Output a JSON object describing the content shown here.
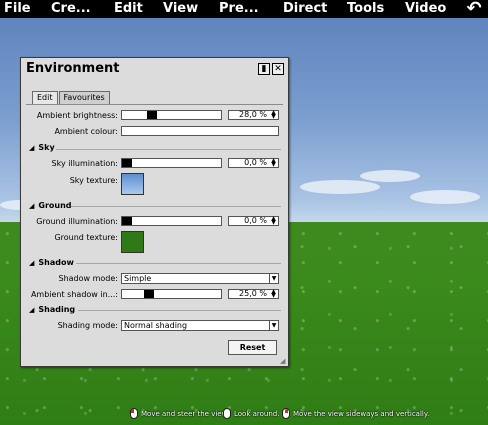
{
  "menu": [
    "File",
    "Cre...",
    "Edit",
    "View",
    "Pre...",
    "Direct",
    "Tools",
    "Video"
  ],
  "undo_symbol": "↶",
  "panel": {
    "title": "Environment",
    "pin_symbol": "▮",
    "close_symbol": "✕",
    "tabs": [
      "Edit",
      "Favourites"
    ],
    "ambient_brightness": {
      "label": "Ambient brightness:",
      "value": "28,0 %",
      "level": 0.28
    },
    "ambient_colour": {
      "label": "Ambient colour:"
    },
    "sky": {
      "title": "Sky",
      "illumination": {
        "label": "Sky illumination:",
        "value": "0,0 %",
        "level": 0.0
      },
      "texture_label": "Sky texture:"
    },
    "ground": {
      "title": "Ground",
      "illumination": {
        "label": "Ground illumination:",
        "value": "0,0 %",
        "level": 0.0
      },
      "texture_label": "Ground texture:"
    },
    "shadow": {
      "title": "Shadow",
      "mode": {
        "label": "Shadow mode:",
        "value": "Simple"
      },
      "ambient": {
        "label": "Ambient shadow in...:",
        "value": "25,0 %",
        "level": 0.25
      }
    },
    "shading": {
      "title": "Shading",
      "mode": {
        "label": "Shading mode:",
        "value": "Normal shading"
      }
    },
    "reset_label": "Reset"
  },
  "hints": [
    "Move and steer the view.",
    "Look around.",
    "Move the view sideways and vertically."
  ],
  "colors": {
    "sky_swatch": "#5f8fd0",
    "ground_swatch": "#2f7a18",
    "menubar": "#000000"
  }
}
